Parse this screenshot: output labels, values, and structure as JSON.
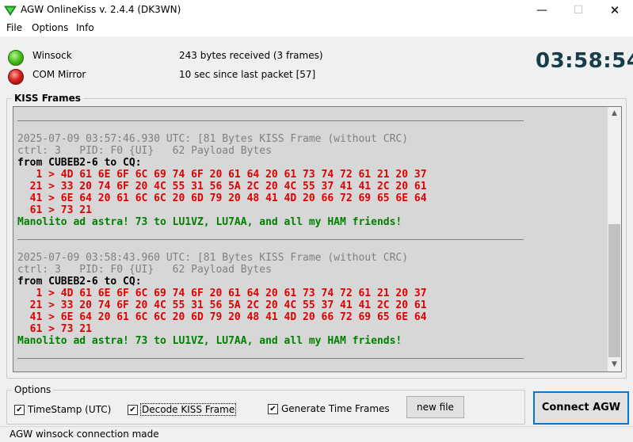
{
  "window": {
    "title": "AGW OnlineKiss v. 2.4.4  (DK3WN)",
    "min_glyph": "—",
    "max_glyph": "☐",
    "close_glyph": "✕"
  },
  "menu": [
    "File",
    "Options",
    "Info"
  ],
  "status": {
    "winsock_label": "Winsock",
    "winsock_led_color": "#4fc31d",
    "winsock_info": "243 bytes received (3 frames)",
    "com_label": "COM Mirror",
    "com_led_color": "#d7231c",
    "com_info": "10 sec since last packet [57]",
    "clock": "03:58:54"
  },
  "kiss": {
    "group_title": "KISS Frames",
    "frames": [
      {
        "header": "2025-07-09 03:57:46.930 UTC: [81 Bytes KISS Frame (without CRC)",
        "ctrl": "ctrl: 3   PID: F0 {UI}   62 Payload Bytes",
        "from": "from CUBEB2-6 to CQ:",
        "hex": [
          "   1 > 4D 61 6E 6F 6C 69 74 6F 20 61 64 20 61 73 74 72 61 21 20 37",
          "  21 > 33 20 74 6F 20 4C 55 31 56 5A 2C 20 4C 55 37 41 41 2C 20 61",
          "  41 > 6E 64 20 61 6C 6C 20 6D 79 20 48 41 4D 20 66 72 69 65 6E 64",
          "  61 > 73 21"
        ],
        "message": "Manolito ad astra! 73 to LU1VZ, LU7AA, and all my HAM friends!"
      },
      {
        "header": "2025-07-09 03:58:43.960 UTC: [81 Bytes KISS Frame (without CRC)",
        "ctrl": "ctrl: 3   PID: F0 {UI}   62 Payload Bytes",
        "from": "from CUBEB2-6 to CQ:",
        "hex": [
          "   1 > 4D 61 6E 6F 6C 69 74 6F 20 61 64 20 61 73 74 72 61 21 20 37",
          "  21 > 33 20 74 6F 20 4C 55 31 56 5A 2C 20 4C 55 37 41 41 2C 20 61",
          "  41 > 6E 64 20 61 6C 6C 20 6D 79 20 48 41 4D 20 66 72 69 65 6E 64",
          "  61 > 73 21"
        ],
        "message": "Manolito ad astra! 73 to LU1VZ, LU7AA, and all my HAM friends!"
      }
    ],
    "scroll_up": "▲",
    "scroll_down": "▼"
  },
  "options": {
    "group_title": "Options",
    "timestamp_label": "TimeStamp (UTC)",
    "timestamp_checked": true,
    "decode_label": "Decode KISS Frame",
    "decode_checked": true,
    "timeframes_label": "Generate Time Frames",
    "timeframes_checked": true,
    "check_glyph": "✔",
    "new_file_label": "new file",
    "connect_label": "Connect AGW"
  },
  "statusbar": {
    "text": "AGW winsock connection made"
  }
}
